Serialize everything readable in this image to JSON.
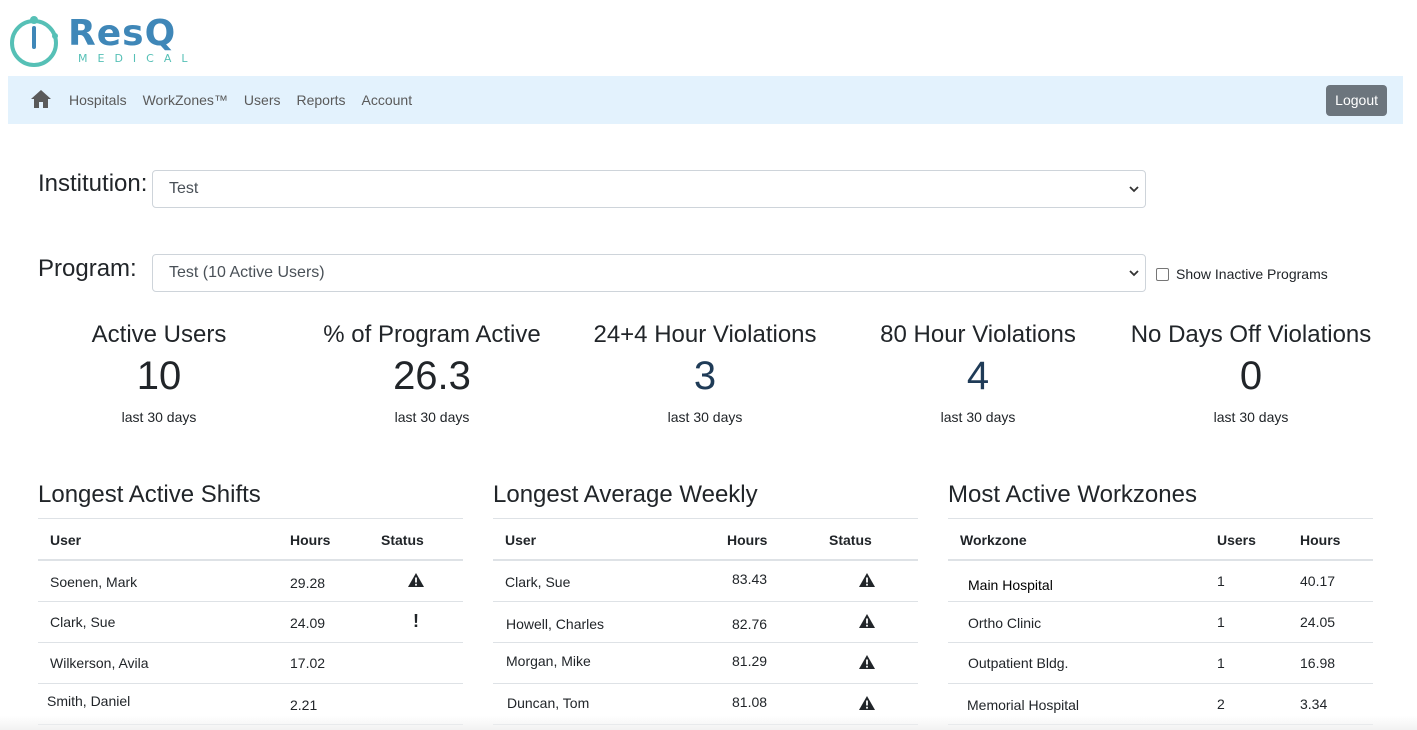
{
  "brand": {
    "name": "ResQ",
    "tagline": "MEDICAL",
    "primary_color": "#3f87b8",
    "accent_color": "#56c0b6"
  },
  "nav": {
    "home_icon": "home-icon",
    "items": [
      {
        "label": "Hospitals"
      },
      {
        "label": "WorkZones™"
      },
      {
        "label": "Users"
      },
      {
        "label": "Reports"
      },
      {
        "label": "Account"
      }
    ],
    "logout_label": "Logout"
  },
  "filters": {
    "institution": {
      "label": "Institution:",
      "value": "Test"
    },
    "program": {
      "label": "Program:",
      "value": "Test (10 Active Users)"
    },
    "show_inactive": {
      "label": "Show Inactive Programs",
      "checked": false
    }
  },
  "stats": [
    {
      "title": "Active Users",
      "value": "10",
      "sub": "last 30 days",
      "color": "#212529"
    },
    {
      "title": "% of Program Active",
      "value": "26.3",
      "sub": "last 30 days",
      "color": "#212529"
    },
    {
      "title": "24+4 Hour Violations",
      "value": "3",
      "sub": "last 30 days",
      "color": "#1f3b57"
    },
    {
      "title": "80 Hour Violations",
      "value": "4",
      "sub": "last 30 days",
      "color": "#1f3b57"
    },
    {
      "title": "No Days Off Violations",
      "value": "0",
      "sub": "last 30 days",
      "color": "#212529"
    }
  ],
  "longest_active_shifts": {
    "title": "Longest Active Shifts",
    "columns": [
      "User",
      "Hours",
      "Status"
    ],
    "rows": [
      {
        "user": "Soenen, Mark",
        "hours": "29.28",
        "status": "warning-icon"
      },
      {
        "user": "Clark, Sue",
        "hours": "24.09",
        "status": "exclamation-icon"
      },
      {
        "user": "Wilkerson, Avila",
        "hours": "17.02",
        "status": ""
      },
      {
        "user": "Smith, Daniel",
        "hours": "2.21",
        "status": ""
      }
    ]
  },
  "longest_average_weekly": {
    "title": "Longest Average Weekly",
    "columns": [
      "User",
      "Hours",
      "Status"
    ],
    "rows": [
      {
        "user": "Clark, Sue",
        "hours": "83.43",
        "status": "warning-icon"
      },
      {
        "user": "Howell, Charles",
        "hours": "82.76",
        "status": "warning-icon"
      },
      {
        "user": "Morgan, Mike",
        "hours": "81.29",
        "status": "warning-icon"
      },
      {
        "user": "Duncan, Tom",
        "hours": "81.08",
        "status": "warning-icon"
      }
    ]
  },
  "most_active_workzones": {
    "title": "Most Active Workzones",
    "columns": [
      "Workzone",
      "Users",
      "Hours"
    ],
    "rows": [
      {
        "workzone": "Main Hospital",
        "users": "1",
        "hours": "40.17"
      },
      {
        "workzone": "Ortho Clinic",
        "users": "1",
        "hours": "24.05"
      },
      {
        "workzone": "Outpatient Bldg.",
        "users": "1",
        "hours": "16.98"
      },
      {
        "workzone": "Memorial Hospital",
        "users": "2",
        "hours": "3.34"
      }
    ]
  }
}
